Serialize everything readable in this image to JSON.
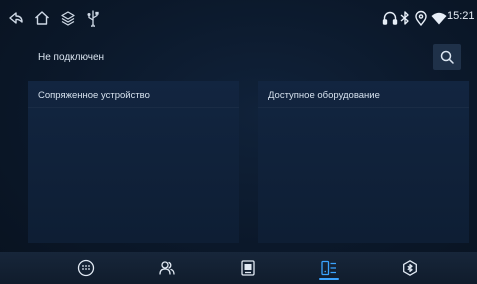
{
  "status_bar": {
    "time": "15:21",
    "left_icons": [
      "back-icon",
      "home-icon",
      "layers-icon",
      "usb-icon"
    ],
    "right_icons": [
      "headphones-icon",
      "bluetooth-icon",
      "location-icon",
      "wifi-icon"
    ]
  },
  "connection": {
    "status_text": "Не подключен",
    "search_icon": "search-icon"
  },
  "panels": {
    "paired": {
      "title": "Сопряженное устройство"
    },
    "available": {
      "title": "Доступное оборудование"
    }
  },
  "bottom_nav": {
    "items": [
      "dialpad-icon",
      "contacts-icon",
      "call-log-icon",
      "devices-icon",
      "bluetooth-settings-icon"
    ],
    "active_index": 3
  },
  "colors": {
    "background": "#0b182a",
    "panel": "#122540",
    "accent": "#3aa3ff",
    "text": "#d6e1ee"
  }
}
